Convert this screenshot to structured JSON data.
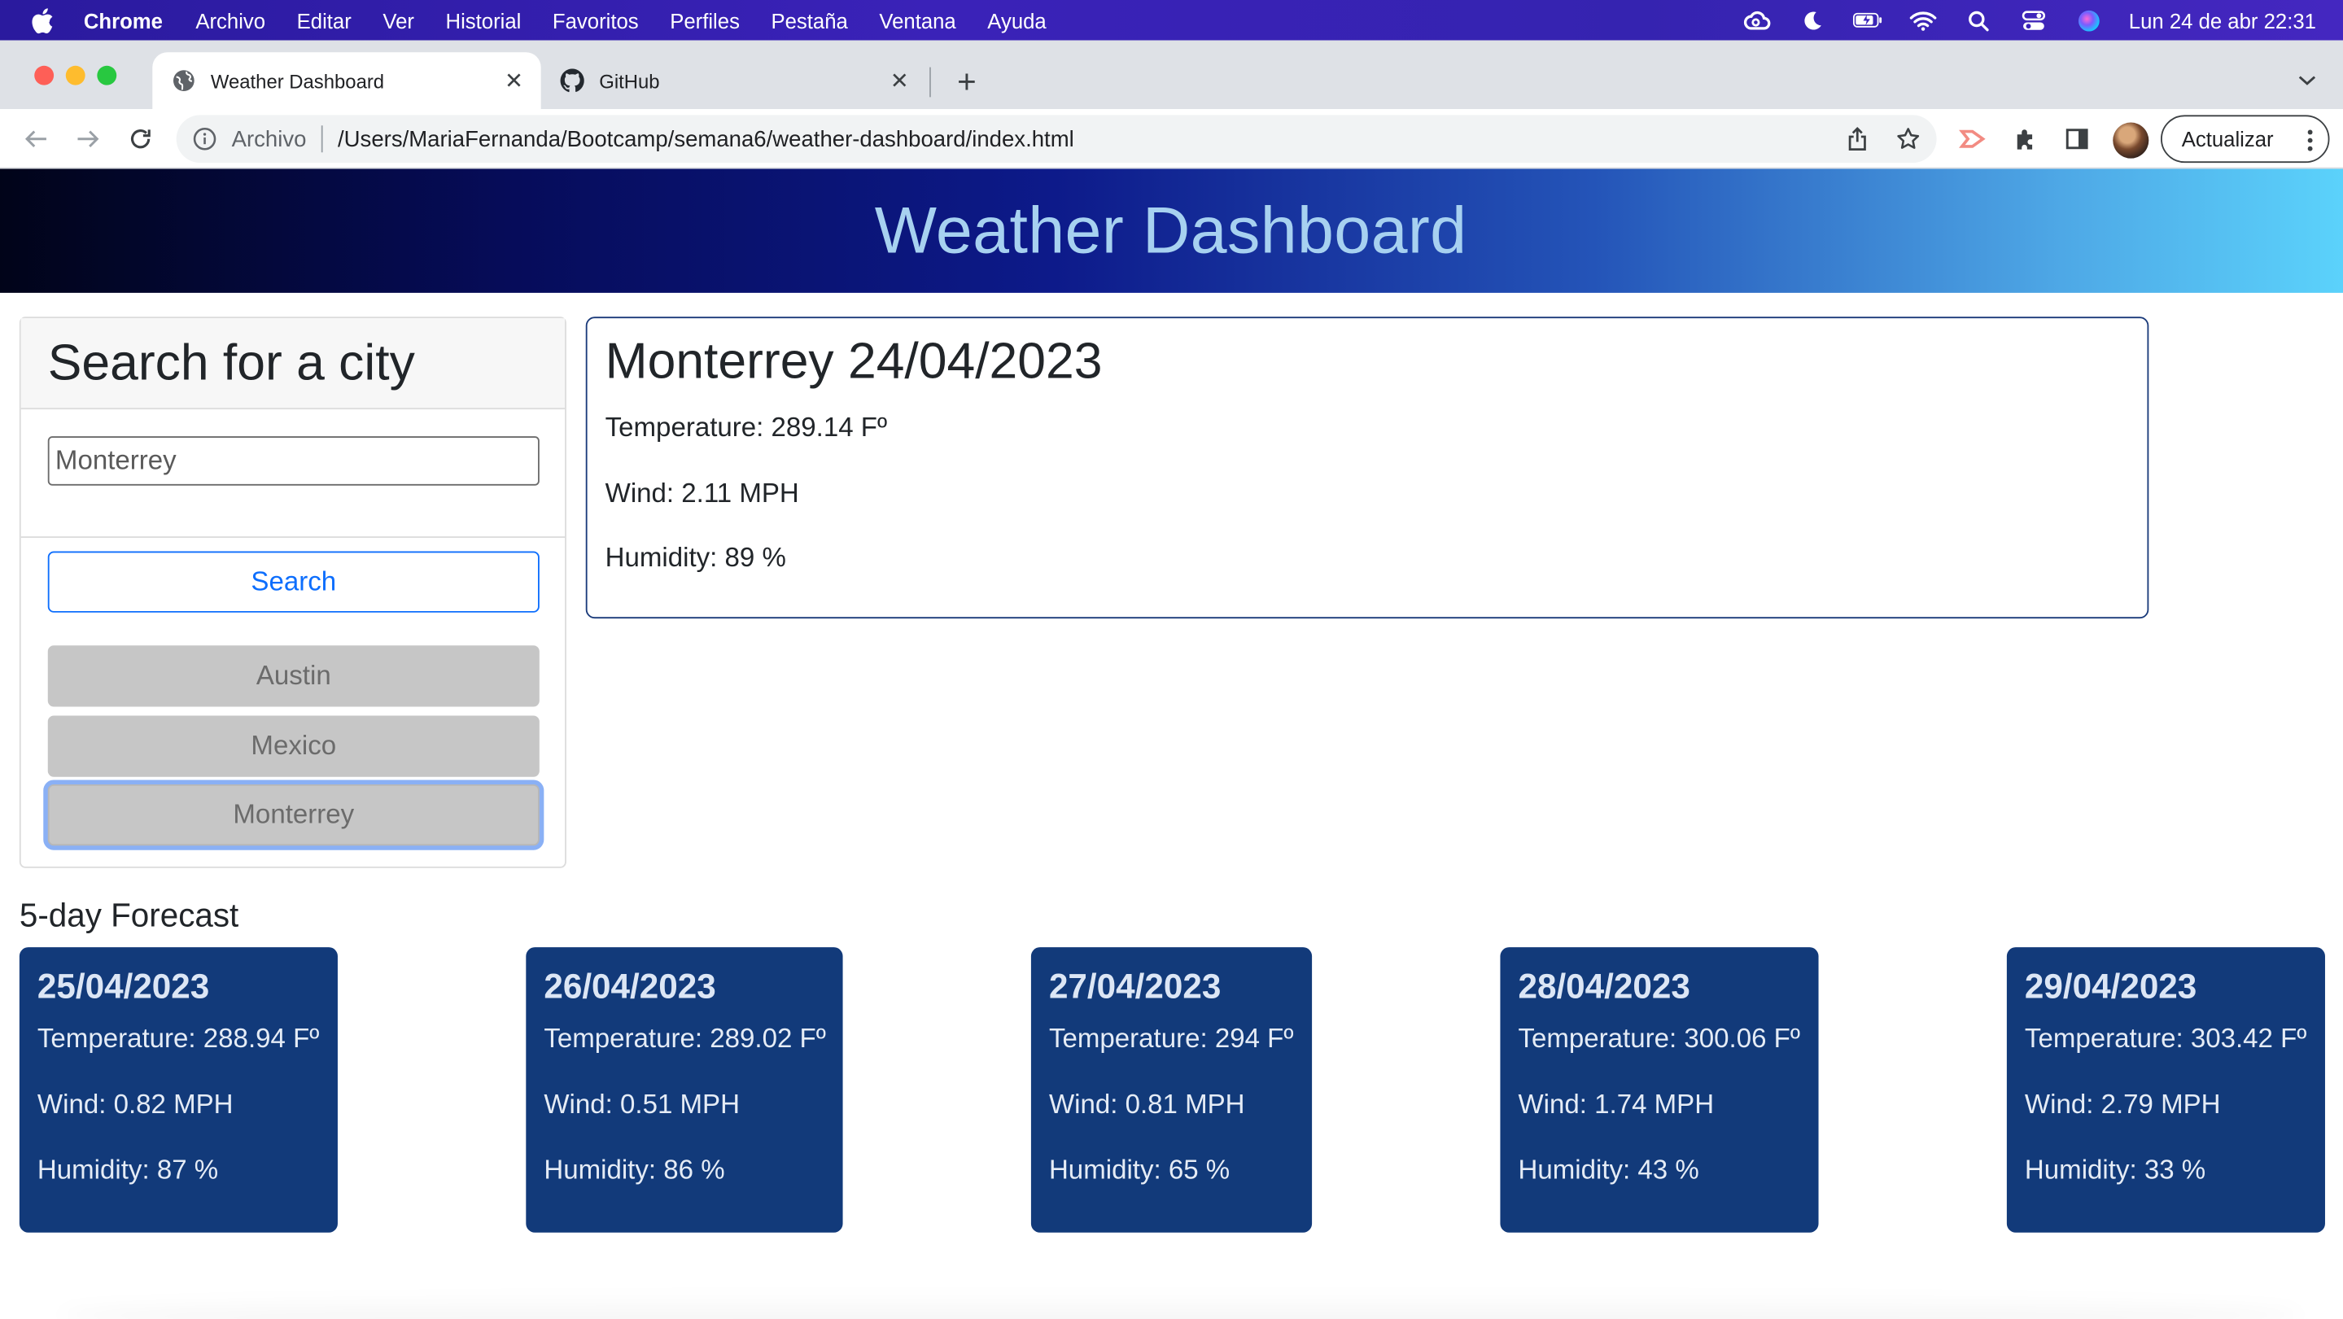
{
  "menubar": {
    "app_name": "Chrome",
    "items": [
      "Archivo",
      "Editar",
      "Ver",
      "Historial",
      "Favoritos",
      "Perfiles",
      "Pestaña",
      "Ventana",
      "Ayuda"
    ],
    "clock": "Lun 24 de abr  22:31",
    "status_icons": [
      "creative-cloud-icon",
      "moon-icon",
      "battery-icon",
      "wifi-icon",
      "spotlight-icon",
      "control-center-icon",
      "siri-icon"
    ]
  },
  "browser": {
    "tabs": [
      {
        "title": "Weather Dashboard",
        "icon": "globe-icon",
        "active": true
      },
      {
        "title": "GitHub",
        "icon": "github-icon",
        "active": false
      }
    ],
    "address": {
      "scheme_label": "Archivo",
      "url": "/Users/MariaFernanda/Bootcamp/semana6/weather-dashboard/index.html"
    },
    "update_button": "Actualizar",
    "colors": {
      "tabstrip": "#dee1e6",
      "toolbar": "#ffffff",
      "omnibox": "#f1f3f4"
    }
  },
  "page": {
    "header_title": "Weather Dashboard",
    "search": {
      "heading": "Search for a city",
      "input_value": "Monterrey",
      "button_label": "Search",
      "history": [
        "Austin",
        "Mexico",
        "Monterrey"
      ]
    },
    "current": {
      "title": "Monterrey 24/04/2023",
      "temperature": "Temperature: 289.14 Fº",
      "wind": "Wind: 2.11 MPH",
      "humidity": "Humidity: 89 %"
    },
    "forecast_title": "5-day Forecast",
    "forecast": [
      {
        "date": "25/04/2023",
        "temperature": "Temperature: 288.94 Fº",
        "wind": "Wind: 0.82 MPH",
        "humidity": "Humidity: 87 %"
      },
      {
        "date": "26/04/2023",
        "temperature": "Temperature: 289.02 Fº",
        "wind": "Wind: 0.51 MPH",
        "humidity": "Humidity: 86 %"
      },
      {
        "date": "27/04/2023",
        "temperature": "Temperature: 294 Fº",
        "wind": "Wind: 0.81 MPH",
        "humidity": "Humidity: 65 %"
      },
      {
        "date": "28/04/2023",
        "temperature": "Temperature: 300.06 Fº",
        "wind": "Wind: 1.74 MPH",
        "humidity": "Humidity: 43 %"
      },
      {
        "date": "29/04/2023",
        "temperature": "Temperature: 303.42 Fº",
        "wind": "Wind: 2.79 MPH",
        "humidity": "Humidity: 33 %"
      }
    ],
    "colors": {
      "forecast_card": "#123a7a",
      "primary": "#0d6efd",
      "history_button": "#c6c6c6",
      "current_border": "#1a3a7a"
    }
  }
}
